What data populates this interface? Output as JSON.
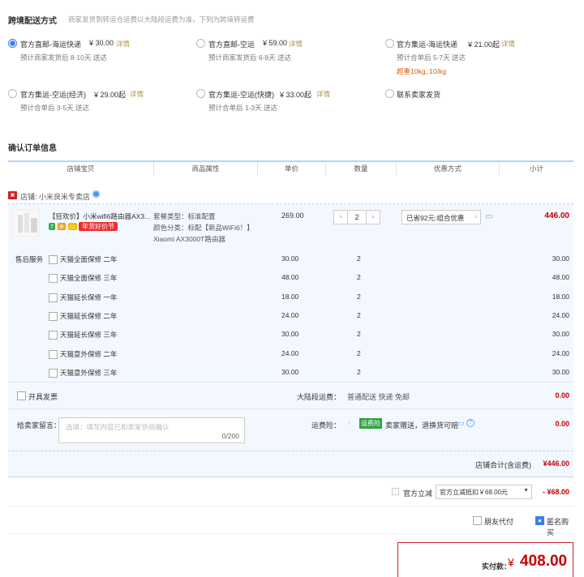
{
  "shipping": {
    "title": "跨境配送方式",
    "note": "商家发货到转运仓运费以大陆段运费为准，下列为跨境转运费",
    "options": [
      {
        "name": "官方直邮-海运快递",
        "price": "¥ 30.00",
        "detail": "详情",
        "desc": "预计商家发货后 8-10天 送达",
        "extra": "",
        "selected": true
      },
      {
        "name": "官方直邮-空运",
        "price": "¥ 59.00",
        "detail": "详情",
        "desc": "预计商家发货后 6-8天 送达",
        "extra": "",
        "selected": false
      },
      {
        "name": "官方集运-海运快递",
        "price": "¥ 21.00起",
        "detail": "详情",
        "desc": "预计合单后 5-7天 送达",
        "extra": "超重10kg, 10/kg",
        "selected": false
      },
      {
        "name": "官方集运-空运(经济)",
        "price": "¥ 29.00起",
        "detail": "详情",
        "desc": "预计合单后 3-5天 送达",
        "extra": "",
        "selected": false
      },
      {
        "name": "官方集运-空运(快捷)",
        "price": "¥ 33.00起",
        "detail": "详情",
        "desc": "预计合单后 1-3天 送达",
        "extra": "",
        "selected": false
      },
      {
        "name": "联系卖家发货",
        "price": "",
        "detail": "",
        "desc": "",
        "extra": "",
        "selected": false
      }
    ]
  },
  "order": {
    "title": "确认订单信息",
    "columns": [
      "店铺宝贝",
      "商品属性",
      "单价",
      "数量",
      "优惠方式",
      "小计"
    ],
    "shop_prefix": "店铺:",
    "shop_name": "小米良米专卖店",
    "item": {
      "title": "【狂欢价】小米wifi6路由器AX3...",
      "promo_badge": "年货好价节",
      "attr1": "套餐类型：标准配置",
      "attr2": "颜色分类：标配【新品WiFi6！】",
      "attr3": "Xiaomi AX3000T路由器",
      "unit_price": "269.00",
      "qty": "2",
      "discount": "已省92元:组合优惠",
      "subtotal": "446.00"
    },
    "service_label": "售后服务",
    "services": [
      {
        "name": "天猫全面保修 二年",
        "price": "30.00",
        "qty": "2",
        "total": "30.00"
      },
      {
        "name": "天猫全面保修 三年",
        "price": "48.00",
        "qty": "2",
        "total": "48.00"
      },
      {
        "name": "天猫延长保修 一年",
        "price": "18.00",
        "qty": "2",
        "total": "18.00"
      },
      {
        "name": "天猫延长保修 二年",
        "price": "24.00",
        "qty": "2",
        "total": "24.00"
      },
      {
        "name": "天猫延长保修 三年",
        "price": "30.00",
        "qty": "2",
        "total": "30.00"
      },
      {
        "name": "天猫意外保修 二年",
        "price": "24.00",
        "qty": "2",
        "total": "24.00"
      },
      {
        "name": "天猫意外保修 三年",
        "price": "30.00",
        "qty": "2",
        "total": "30.00"
      }
    ],
    "invoice_label": "开具发票",
    "mainland_fee_label": "大陆段运费：",
    "mainland_fee_value": "普通配送 快递 免邮",
    "mainland_fee_amount": "0.00",
    "message_label": "给卖家留言：",
    "message_placeholder": "选填：填写内容已和卖家协商确认",
    "message_count": "0/200",
    "insurance_label": "运费险：",
    "insurance_badge": "运费险",
    "insurance_text": "卖家赠送，退换货可赔",
    "insurance_amount": "0.00",
    "shop_total_label": "店铺合计(含运费)",
    "shop_total_value": "¥446.00",
    "official_discount_label": "官方立减",
    "official_discount_select": "官方立减抵扣￥68.00元",
    "official_discount_value": "- ¥68.00",
    "friend_pay_label": "朋友代付",
    "anonymous_label": "匿名购买",
    "pay_label": "实付款：",
    "pay_currency": "¥",
    "pay_value": "408.00"
  },
  "colors": {
    "accent": "#3d7ee8",
    "price_red": "#c40000",
    "gold": "#b59252"
  }
}
